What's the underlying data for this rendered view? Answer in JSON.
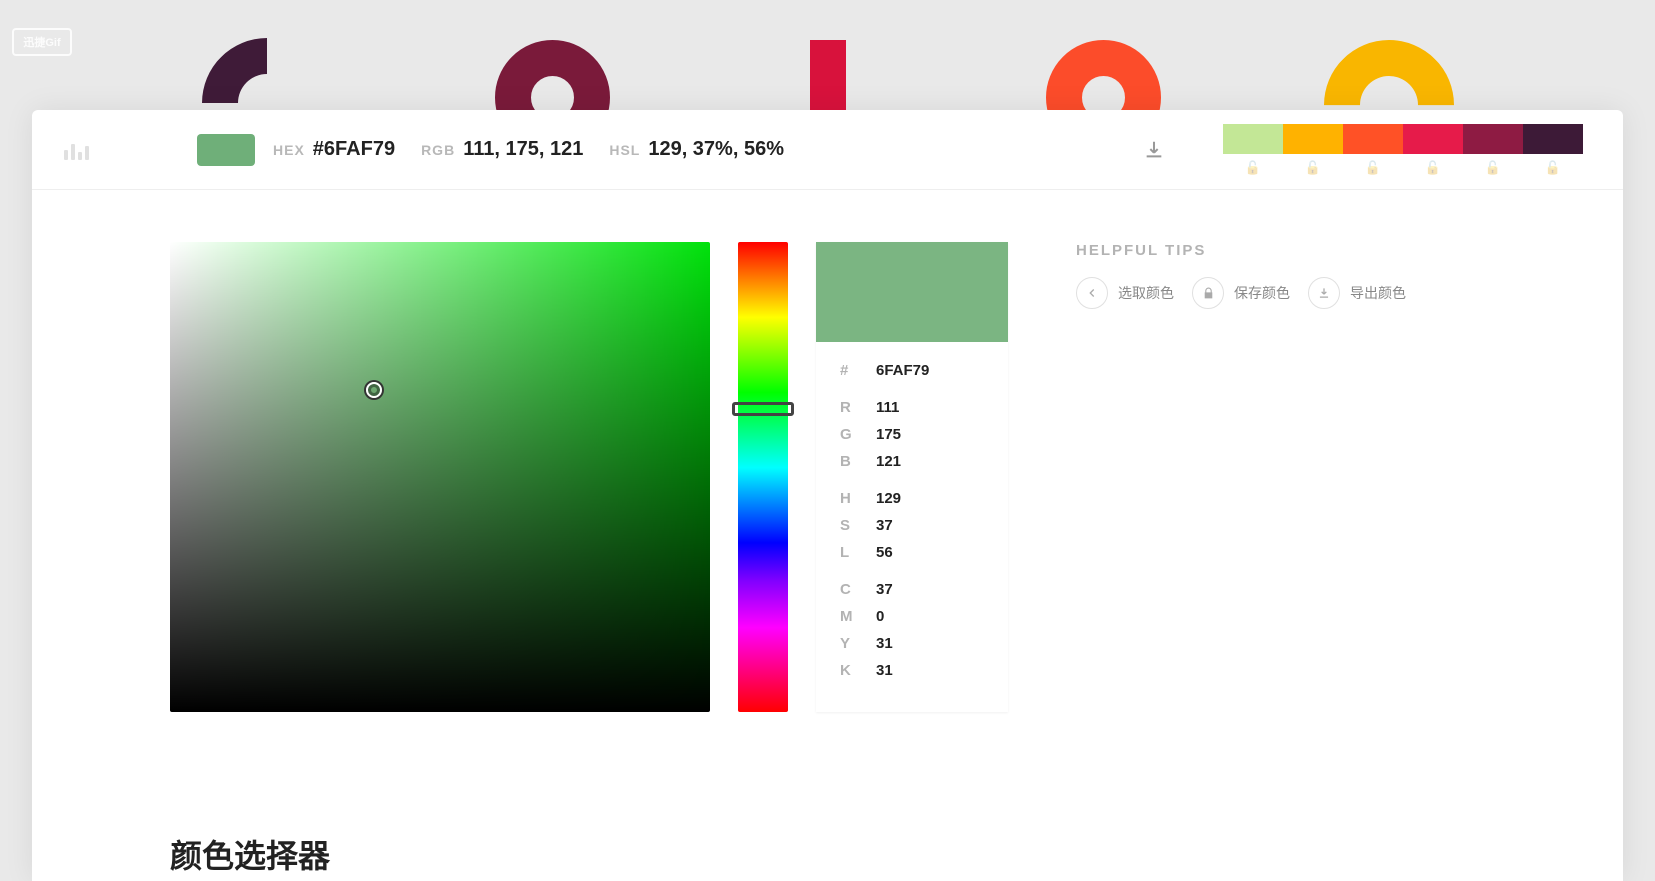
{
  "watermark": "迅捷Gif",
  "topbar": {
    "hex_label": "HEX",
    "hex_value": "#6FAF79",
    "rgb_label": "RGB",
    "rgb_value": "111, 175, 121",
    "hsl_label": "HSL",
    "hsl_value": "129, 37%, 56%"
  },
  "palette": [
    "#c3e796",
    "#ffb200",
    "#ff5126",
    "#e61b4a",
    "#8e1b43",
    "#3d1a37"
  ],
  "card": {
    "hash": "#",
    "hex": "6FAF79",
    "r_label": "R",
    "r": "111",
    "g_label": "G",
    "g": "175",
    "b_label": "B",
    "b": "121",
    "h_label": "H",
    "h": "129",
    "s_label": "S",
    "s": "37",
    "l_label": "L",
    "l": "56",
    "c_label": "C",
    "c": "37",
    "m_label": "M",
    "m": "0",
    "y_label": "Y",
    "y": "31",
    "k_label": "K",
    "k": "31"
  },
  "tips": {
    "title": "HELPFUL TIPS",
    "pick": "选取颜色",
    "save": "保存颜色",
    "export": "导出颜色"
  },
  "heading": "颜色选择器",
  "current_color": "#6FAF79"
}
